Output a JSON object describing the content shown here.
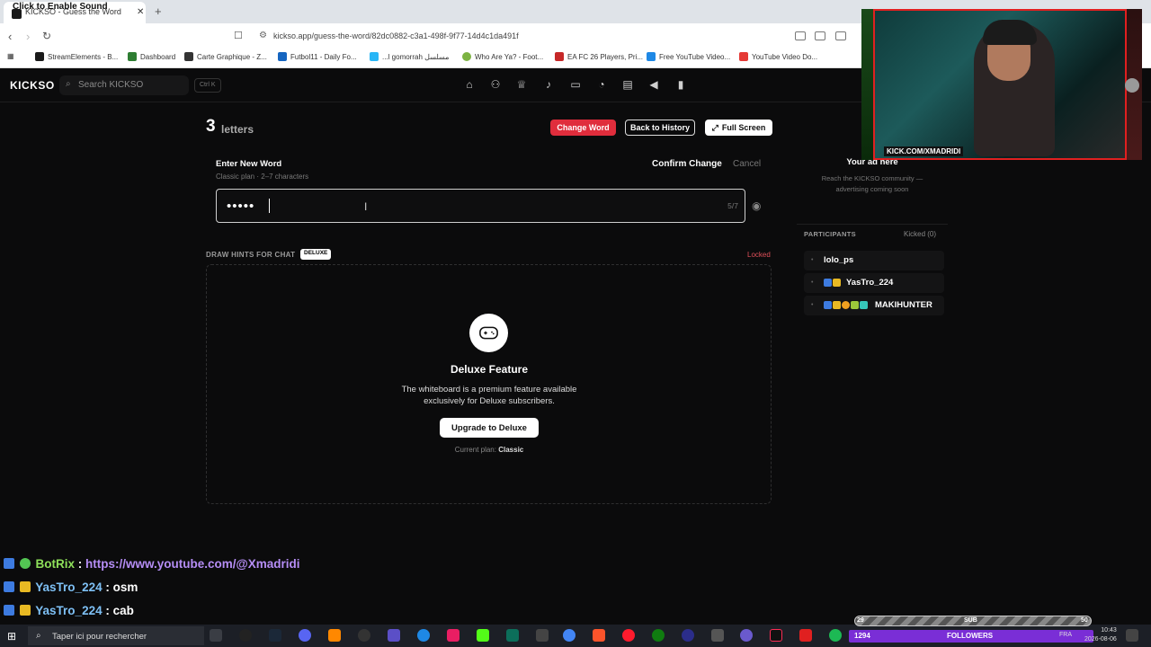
{
  "browser": {
    "tab_sound": "Click to Enable Sound",
    "tab_title": "KICKSO - Guess the Word",
    "url": "kickso.app/guess-the-word/82dc0882-c3a1-498f-9f77-14d4c1da491f",
    "bookmarks": [
      {
        "label": "StreamElements - B...",
        "color": "#1a1a1a"
      },
      {
        "label": "Dashboard",
        "color": "#2e7d32"
      },
      {
        "label": "Carte Graphique - Z...",
        "color": "#333333"
      },
      {
        "label": "Futbol11 - Daily Fo...",
        "color": "#1565c0"
      },
      {
        "label": "...l gomorrah مسلسل",
        "color": "#29b6f6"
      },
      {
        "label": "Who Are Ya? - Foot...",
        "color": "#7cb342"
      },
      {
        "label": "EA FC 26 Players, Pri...",
        "color": "#c62828"
      },
      {
        "label": "Free YouTube Video...",
        "color": "#1e88e5"
      },
      {
        "label": "YouTube Video Do...",
        "color": "#e53935"
      }
    ]
  },
  "header": {
    "logo": "KICKSO",
    "search_placeholder": "Search KICKSO",
    "shortcut": "Ctrl K",
    "nav_icons": [
      "home-icon",
      "users-icon",
      "trophy-icon",
      "microphone-icon",
      "monitor-icon",
      "pie-chart-icon",
      "news-icon",
      "megaphone-icon",
      "game-card-icon"
    ]
  },
  "game": {
    "letter_count": "3",
    "letters_label": "letters",
    "change_word": "Change Word",
    "back_history": "Back to History",
    "full_screen": "Full Screen",
    "enter_title": "Enter New Word",
    "enter_sub": "Classic plan · 2–7 characters",
    "confirm": "Confirm Change",
    "cancel": "Cancel",
    "masked_value": "•••••",
    "char_count": "5/7"
  },
  "hints": {
    "label": "DRAW HINTS FOR CHAT",
    "badge": "DELUXE",
    "locked": "Locked",
    "title": "Deluxe Feature",
    "description": "The whiteboard is a premium feature available exclusively for Deluxe subscribers.",
    "upgrade": "Upgrade to Deluxe",
    "plan_prefix": "Current plan:",
    "plan_name": "Classic"
  },
  "sidebar": {
    "ad_title": "Your ad here",
    "ad_desc": "Reach the KICKSO community — advertising coming soon",
    "participants_label": "PARTICIPANTS",
    "kicked": "Kicked (0)",
    "participants": [
      {
        "name": "lolo_ps"
      },
      {
        "name": "YasTro_224"
      },
      {
        "name": "MAKIHUNTER"
      }
    ]
  },
  "stream": {
    "cam_label": "KICK.COM/XMADRIDI",
    "chat": [
      {
        "user": "BotRix",
        "sep": " : ",
        "msg": "https://www.youtube.com/@Xmadridi"
      },
      {
        "user": "YasTro_224",
        "sep": " : ",
        "msg": "osm"
      },
      {
        "user": "YasTro_224",
        "sep": " : ",
        "msg": "cab"
      }
    ],
    "followers_label": "FOLLOWERS",
    "followers_count": "1294",
    "sub_label": "SUB",
    "sub_min": "29",
    "sub_max": "50"
  },
  "taskbar": {
    "search_placeholder": "Taper ici pour rechercher",
    "lang": "FRA",
    "time": "10:43",
    "date": "2026-08-06"
  }
}
